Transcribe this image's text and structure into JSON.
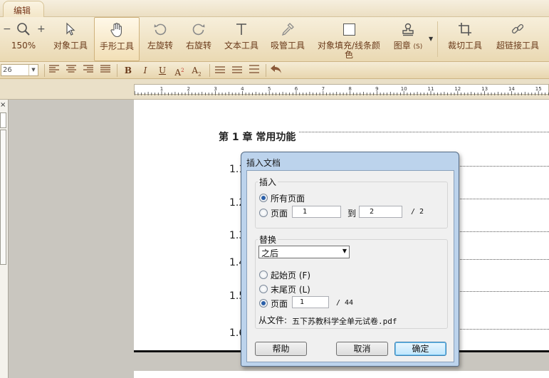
{
  "tabs": {
    "edit": "编辑"
  },
  "ribbon": {
    "zoom_value": "150%",
    "zoom_out_icon": "minus-icon",
    "zoom_in_icon": "plus-icon",
    "object_tool": "对象工具",
    "hand_tool": "手形工具",
    "rotate_left": "左旋转",
    "rotate_right": "右旋转",
    "text_tool": "文本工具",
    "eyedropper_tool": "吸管工具",
    "fill_line_color_1": "对象填充/线条颜",
    "fill_line_color_2": "色",
    "stamp": "图章",
    "stamp_shortcut": "(S)",
    "crop_tool": "裁切工具",
    "hyperlink_tool": "超链接工具"
  },
  "format": {
    "font_size": "26",
    "bold": "B",
    "italic": "I",
    "underline": "U",
    "superscript": "A",
    "sup_mark": "2",
    "subscript": "A",
    "sub_mark": "2"
  },
  "ruler": {
    "labels": [
      "1",
      "2",
      "3",
      "4",
      "5",
      "6",
      "7",
      "8",
      "9",
      "10",
      "11",
      "12",
      "13",
      "14",
      "15"
    ]
  },
  "document": {
    "chapter_title": "第 1 章  常用功能",
    "sections": [
      "1.1",
      "1.2",
      "1.3",
      "1.4",
      "1.5",
      "1.6"
    ]
  },
  "dialog": {
    "title": "插入文档",
    "insert_group": "插入",
    "all_pages": "所有页面",
    "pages_label": "页面",
    "from_page": "1",
    "to_label": "到",
    "to_page": "2",
    "total_source": "/ 2",
    "replace_group": "替换",
    "position_select": "之后",
    "start_page": "起始页 (F)",
    "end_page": "末尾页 (L)",
    "page_label": "页面",
    "page_value": "1",
    "page_total": "/  44",
    "from_file_label": "从文件:",
    "from_file_value": "五下苏教科学全单元试卷.pdf",
    "help_button": "帮助",
    "cancel_button": "取消",
    "ok_button": "确定"
  }
}
